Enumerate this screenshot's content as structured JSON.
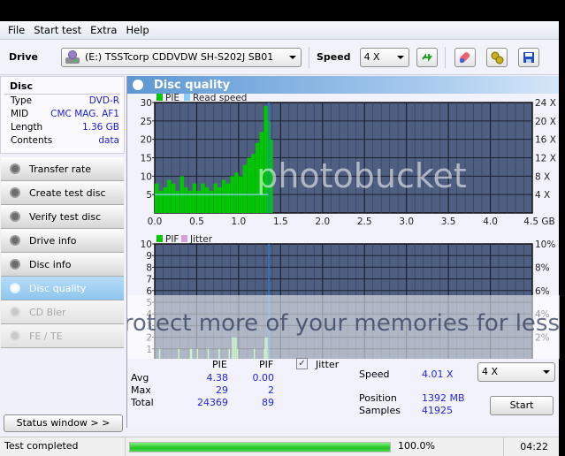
{
  "menu": [
    "File",
    "Start test",
    "Extra",
    "Help"
  ],
  "toolbar": {
    "drive_label": "Drive",
    "drive_value": "(E:)  TSSTcorp CDDVDW SH-S202J SB01",
    "speed_label": "Speed",
    "speed_value": "4 X",
    "icons": [
      "refresh-icon",
      "eraser-icon",
      "settings-icon",
      "save-icon"
    ]
  },
  "disc": {
    "title": "Disc",
    "rows": [
      {
        "label": "Type",
        "value": "DVD-R"
      },
      {
        "label": "MID",
        "value": "CMC MAG. AF1"
      },
      {
        "label": "Length",
        "value": "1.36 GB"
      },
      {
        "label": "Contents",
        "value": "data"
      }
    ]
  },
  "nav": [
    {
      "label": "Transfer rate",
      "state": "normal"
    },
    {
      "label": "Create test disc",
      "state": "normal"
    },
    {
      "label": "Verify test disc",
      "state": "normal"
    },
    {
      "label": "Drive info",
      "state": "normal"
    },
    {
      "label": "Disc info",
      "state": "normal"
    },
    {
      "label": "Disc quality",
      "state": "active"
    },
    {
      "label": "CD Bler",
      "state": "disabled"
    },
    {
      "label": "FE / TE",
      "state": "disabled"
    }
  ],
  "status_window_label": "Status window > >",
  "panel_title": "Disc quality",
  "watermark": {
    "brand": "photobucket",
    "tagline": "Protect more of your memories for less!"
  },
  "chart_data": [
    {
      "type": "bar",
      "title": "PIE",
      "legend": [
        {
          "name": "PIE",
          "color": "#00c800"
        },
        {
          "name": "Read speed",
          "color": "#87cefa"
        }
      ],
      "xlabel": "GB",
      "x_ticks": [
        "0.0",
        "0.5",
        "1.0",
        "1.5",
        "2.0",
        "2.5",
        "3.0",
        "3.5",
        "4.0",
        "4.5 GB"
      ],
      "xlim": [
        0,
        4.5
      ],
      "y_ticks": [
        "5",
        "10",
        "15",
        "20",
        "25",
        "30"
      ],
      "ylim": [
        0,
        30
      ],
      "y2_ticks": [
        "4 X",
        "8 X",
        "12 X",
        "16 X",
        "20 X",
        "24 X"
      ],
      "y2lim": [
        0,
        24
      ],
      "grid": true,
      "legend_position": "top-left",
      "series": [
        {
          "name": "PIE",
          "x": [
            0.0,
            0.05,
            0.1,
            0.15,
            0.2,
            0.25,
            0.3,
            0.35,
            0.4,
            0.45,
            0.5,
            0.55,
            0.6,
            0.65,
            0.7,
            0.75,
            0.8,
            0.85,
            0.9,
            0.95,
            1.0,
            1.05,
            1.1,
            1.15,
            1.2,
            1.25,
            1.3,
            1.33,
            1.36
          ],
          "values": [
            8,
            6,
            7,
            9,
            8,
            6,
            10,
            7,
            6,
            8,
            6,
            8,
            7,
            6,
            8,
            7,
            9,
            8,
            10,
            11,
            10,
            13,
            15,
            16,
            19,
            22,
            29,
            25,
            20
          ]
        },
        {
          "name": "Read speed",
          "x": [
            0.0,
            1.36
          ],
          "values": [
            4.01,
            4.01
          ]
        }
      ],
      "position_marker": 1.36
    },
    {
      "type": "bar",
      "title": "PIF",
      "legend": [
        {
          "name": "PIF",
          "color": "#00c800"
        },
        {
          "name": "Jitter",
          "color": "#d8a0d8"
        }
      ],
      "xlabel": "GB",
      "x_ticks": [
        "0.0",
        "0.5",
        "1.0",
        "1.5",
        "2.0",
        "2.5",
        "3.0",
        "3.5",
        "4.0",
        "4.5 GB"
      ],
      "xlim": [
        0,
        4.5
      ],
      "y_ticks": [
        "1",
        "2",
        "3",
        "4",
        "5",
        "6",
        "7",
        "8",
        "9",
        "10"
      ],
      "ylim": [
        0,
        10
      ],
      "y2_ticks": [
        "2%",
        "4%",
        "6%",
        "8%",
        "10%"
      ],
      "y2lim": [
        0,
        10
      ],
      "grid": true,
      "legend_position": "top-left",
      "series": [
        {
          "name": "PIF",
          "x": [
            0.05,
            0.28,
            0.42,
            0.43,
            0.5,
            0.63,
            0.76,
            0.88,
            0.92,
            0.94,
            0.96,
            0.98,
            1.18,
            1.3,
            1.31,
            1.33,
            1.35
          ],
          "values": [
            1,
            1,
            1,
            1,
            1,
            1,
            1,
            1,
            2,
            2,
            2,
            1,
            1,
            1,
            2,
            2,
            1
          ]
        }
      ],
      "position_marker": 1.36
    }
  ],
  "stats": {
    "headers": [
      "PIE",
      "PIF"
    ],
    "jitter_label": "Jitter",
    "jitter_checked": true,
    "rows": [
      {
        "label": "Avg",
        "pie": "4.38",
        "pif": "0.00"
      },
      {
        "label": "Max",
        "pie": "29",
        "pif": "2"
      },
      {
        "label": "Total",
        "pie": "24369",
        "pif": "89"
      }
    ],
    "speed_label": "Speed",
    "speed_value": "4.01 X",
    "position_label": "Position",
    "position_value": "1392 MB",
    "samples_label": "Samples",
    "samples_value": "41925",
    "speed_select": "4 X",
    "start_label": "Start"
  },
  "statusbar": {
    "text": "Test completed",
    "progress": 1.0,
    "percent": "100.0%",
    "time": "04:22"
  }
}
